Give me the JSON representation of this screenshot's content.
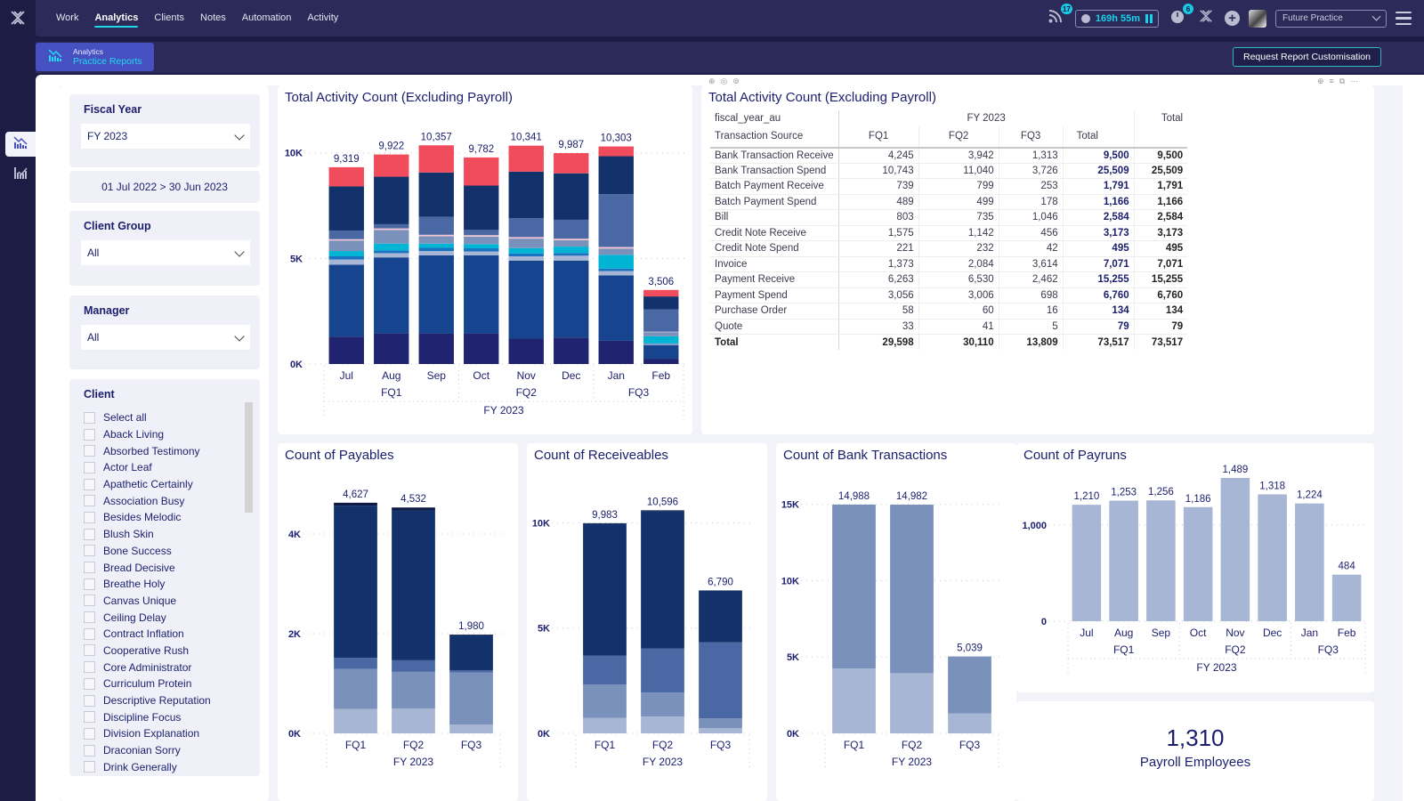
{
  "app": {
    "top_nav": [
      {
        "label": "Work",
        "active": false
      },
      {
        "label": "Analytics",
        "active": true
      },
      {
        "label": "Clients",
        "active": false
      },
      {
        "label": "Notes",
        "active": false
      },
      {
        "label": "Automation",
        "active": false
      },
      {
        "label": "Activity",
        "active": false
      }
    ],
    "feed_badge": "17",
    "timer_value": "169h 55m",
    "timer_badge": "6",
    "practice_select": "Future Practice",
    "report_tab": {
      "section": "Analytics",
      "name": "Practice Reports"
    },
    "request_button": "Request Report Customisation",
    "colors": {
      "accent": "#1ed8e8",
      "brand": "#4650c0",
      "nav_bg": "#2b2a58",
      "title": "#1b1e6c"
    }
  },
  "filters": {
    "fiscal_year": {
      "label": "Fiscal Year",
      "value": "FY 2023",
      "range": "01 Jul 2022 > 30 Jun 2023"
    },
    "client_group": {
      "label": "Client Group",
      "value": "All"
    },
    "manager": {
      "label": "Manager",
      "value": "All"
    },
    "client": {
      "label": "Client",
      "items": [
        "Select all",
        "Aback Living",
        "Absorbed Testimony",
        "Actor Leaf",
        "Apathetic Certainly",
        "Association Busy",
        "Besides Melodic",
        "Blush Skin",
        "Bone Success",
        "Bread Decisive",
        "Breathe Holy",
        "Canvas Unique",
        "Ceiling Delay",
        "Contract Inflation",
        "Cooperative Rush",
        "Core Administrator",
        "Curriculum Protein",
        "Descriptive Reputation",
        "Discipline Focus",
        "Division Explanation",
        "Draconian Sorry",
        "Drink Generally"
      ]
    }
  },
  "table": {
    "title": "Total Activity Count (Excluding Payroll)",
    "row_header_1": "fiscal_year_au",
    "row_header_2": "Transaction Source",
    "group_label": "FY 2023",
    "grand_total_label": "Total",
    "columns": [
      "FQ1",
      "FQ2",
      "FQ3",
      "Total"
    ],
    "rows": [
      {
        "name": "Bank Transaction Receive",
        "values": [
          "4,245",
          "3,942",
          "1,313",
          "9,500"
        ],
        "total": "9,500"
      },
      {
        "name": "Bank Transaction Spend",
        "values": [
          "10,743",
          "11,040",
          "3,726",
          "25,509"
        ],
        "total": "25,509"
      },
      {
        "name": "Batch Payment Receive",
        "values": [
          "739",
          "799",
          "253",
          "1,791"
        ],
        "total": "1,791"
      },
      {
        "name": "Batch Payment Spend",
        "values": [
          "489",
          "499",
          "178",
          "1,166"
        ],
        "total": "1,166"
      },
      {
        "name": "Bill",
        "values": [
          "803",
          "735",
          "1,046",
          "2,584"
        ],
        "total": "2,584"
      },
      {
        "name": "Credit Note Receive",
        "values": [
          "1,575",
          "1,142",
          "456",
          "3,173"
        ],
        "total": "3,173"
      },
      {
        "name": "Credit Note Spend",
        "values": [
          "221",
          "232",
          "42",
          "495"
        ],
        "total": "495"
      },
      {
        "name": "Invoice",
        "values": [
          "1,373",
          "2,084",
          "3,614",
          "7,071"
        ],
        "total": "7,071"
      },
      {
        "name": "Payment Receive",
        "values": [
          "6,263",
          "6,530",
          "2,462",
          "15,255"
        ],
        "total": "15,255"
      },
      {
        "name": "Payment Spend",
        "values": [
          "3,056",
          "3,006",
          "698",
          "6,760"
        ],
        "total": "6,760"
      },
      {
        "name": "Purchase Order",
        "values": [
          "58",
          "60",
          "16",
          "134"
        ],
        "total": "134"
      },
      {
        "name": "Quote",
        "values": [
          "33",
          "41",
          "5",
          "79"
        ],
        "total": "79"
      }
    ],
    "total_row": {
      "name": "Total",
      "values": [
        "29,598",
        "30,110",
        "13,809",
        "73,517"
      ],
      "total": "73,517"
    }
  },
  "kpi": {
    "value": "1,310",
    "label": "Payroll Employees"
  },
  "chart_data": [
    {
      "id": "activity",
      "type": "bar",
      "stacked": true,
      "title": "Total Activity Count (Excluding Payroll)",
      "categories": [
        "Jul",
        "Aug",
        "Sep",
        "Oct",
        "Nov",
        "Dec",
        "Jan",
        "Feb"
      ],
      "quarters": [
        {
          "label": "FQ1",
          "span": 3
        },
        {
          "label": "FQ2",
          "span": 3
        },
        {
          "label": "FQ3",
          "span": 2
        }
      ],
      "year_label": "FY 2023",
      "yticks": [
        {
          "v": 0,
          "label": "0K"
        },
        {
          "v": 5000,
          "label": "5K"
        },
        {
          "v": 10000,
          "label": "10K"
        }
      ],
      "ylim": [
        0,
        11000
      ],
      "totals": [
        9319,
        9922,
        10357,
        9782,
        10341,
        9987,
        10303,
        3506
      ],
      "series": [
        {
          "name": "Payment Spend",
          "color": "#1f2370",
          "values": [
            1300,
            1450,
            1450,
            1450,
            1200,
            1250,
            1100,
            250
          ]
        },
        {
          "name": "Bank Transaction Spend",
          "color": "#17448e",
          "values": [
            3400,
            3600,
            3700,
            3700,
            3700,
            3650,
            3100,
            650
          ]
        },
        {
          "name": "Batch Payment Receive",
          "color": "#a7b6d4",
          "values": [
            250,
            200,
            200,
            180,
            200,
            230,
            200,
            50
          ]
        },
        {
          "name": "Batch Payment Spend",
          "color": "#1a73c0",
          "values": [
            150,
            130,
            150,
            150,
            130,
            130,
            120,
            30
          ]
        },
        {
          "name": "Bill",
          "color": "#00b4d4",
          "values": [
            250,
            320,
            200,
            200,
            260,
            300,
            650,
            330
          ]
        },
        {
          "name": "Credit Note Receive",
          "color": "#7a91bc",
          "values": [
            500,
            650,
            350,
            350,
            450,
            300,
            300,
            200
          ]
        },
        {
          "name": "Credit Note Spend",
          "color": "#f7c5d0",
          "values": [
            60,
            70,
            70,
            70,
            70,
            70,
            70,
            20
          ]
        },
        {
          "name": "Invoice",
          "color": "#4a69a4",
          "values": [
            400,
            200,
            850,
            250,
            900,
            900,
            2500,
            1050
          ]
        },
        {
          "name": "Payment Receive",
          "color": "#13326b",
          "values": [
            2100,
            2250,
            2100,
            2100,
            2200,
            2200,
            1800,
            620
          ]
        },
        {
          "name": "Bank Transaction Receive",
          "color": "#f04c5c",
          "values": [
            909,
            1052,
            1287,
            1332,
            1231,
            957,
            463,
            306
          ]
        }
      ]
    },
    {
      "id": "payables",
      "type": "bar",
      "stacked": true,
      "title": "Count of Payables",
      "categories": [
        "FQ1",
        "FQ2",
        "FQ3"
      ],
      "year_label": "FY 2023",
      "yticks": [
        {
          "v": 0,
          "label": "0K"
        },
        {
          "v": 2000,
          "label": "2K"
        },
        {
          "v": 4000,
          "label": "4K"
        }
      ],
      "ylim": [
        0,
        5000
      ],
      "totals": [
        4627,
        4532,
        1980
      ],
      "series": [
        {
          "name": "Payment Spend",
          "color": "#a7b6d4",
          "values": [
            489,
            499,
            178
          ]
        },
        {
          "name": "Bill",
          "color": "#7a91bc",
          "values": [
            803,
            735,
            1046
          ]
        },
        {
          "name": "Credit Note Spend",
          "color": "#4a69a4",
          "values": [
            221,
            232,
            42
          ]
        },
        {
          "name": "Bank Transaction Spend",
          "color": "#13326b",
          "values": [
            3056,
            3006,
            698
          ]
        },
        {
          "name": "Purchase Order",
          "color": "#0c1a45",
          "values": [
            58,
            60,
            16
          ]
        }
      ]
    },
    {
      "id": "receivables",
      "type": "bar",
      "stacked": true,
      "title": "Count of Receiveables",
      "categories": [
        "FQ1",
        "FQ2",
        "FQ3"
      ],
      "year_label": "FY 2023",
      "yticks": [
        {
          "v": 0,
          "label": "0K"
        },
        {
          "v": 5000,
          "label": "5K"
        },
        {
          "v": 10000,
          "label": "10K"
        }
      ],
      "ylim": [
        0,
        11500
      ],
      "totals": [
        9983,
        10596,
        6790
      ],
      "series": [
        {
          "name": "Batch Payment Receive",
          "color": "#a7b6d4",
          "values": [
            739,
            799,
            253
          ]
        },
        {
          "name": "Credit Note Receive",
          "color": "#7a91bc",
          "values": [
            1575,
            1142,
            456
          ]
        },
        {
          "name": "Invoice",
          "color": "#4a69a4",
          "values": [
            1373,
            2084,
            3614
          ]
        },
        {
          "name": "Payment Receive",
          "color": "#13326b",
          "values": [
            6263,
            6530,
            2462
          ]
        },
        {
          "name": "Quote",
          "color": "#0c1a45",
          "values": [
            33,
            41,
            5
          ]
        }
      ]
    },
    {
      "id": "bank",
      "type": "bar",
      "stacked": true,
      "title": "Count of Bank Transactions",
      "categories": [
        "FQ1",
        "FQ2",
        "FQ3"
      ],
      "year_label": "FY 2023",
      "yticks": [
        {
          "v": 0,
          "label": "0K"
        },
        {
          "v": 5000,
          "label": "5K"
        },
        {
          "v": 10000,
          "label": "10K"
        },
        {
          "v": 15000,
          "label": "15K"
        }
      ],
      "ylim": [
        0,
        16500
      ],
      "totals": [
        14988,
        14982,
        5039
      ],
      "series": [
        {
          "name": "Bank Transaction Receive",
          "color": "#a7b6d4",
          "values": [
            4245,
            3942,
            1313
          ]
        },
        {
          "name": "Bank Transaction Spend",
          "color": "#7a91bc",
          "values": [
            10743,
            11040,
            3726
          ]
        }
      ]
    },
    {
      "id": "payruns",
      "type": "bar",
      "stacked": false,
      "title": "Count of Payruns",
      "categories": [
        "Jul",
        "Aug",
        "Sep",
        "Oct",
        "Nov",
        "Dec",
        "Jan",
        "Feb"
      ],
      "quarters": [
        {
          "label": "FQ1",
          "span": 3
        },
        {
          "label": "FQ2",
          "span": 3
        },
        {
          "label": "FQ3",
          "span": 2
        }
      ],
      "year_label": "FY 2023",
      "yticks": [
        {
          "v": 0,
          "label": "0"
        },
        {
          "v": 1000,
          "label": "1,000"
        }
      ],
      "ylim": [
        0,
        1489
      ],
      "totals": [
        1210,
        1253,
        1256,
        1186,
        1489,
        1318,
        1224,
        484
      ],
      "series": [
        {
          "name": "Payruns",
          "color": "#a7b6d4",
          "values": [
            1210,
            1253,
            1256,
            1186,
            1489,
            1318,
            1224,
            484
          ]
        }
      ]
    }
  ]
}
